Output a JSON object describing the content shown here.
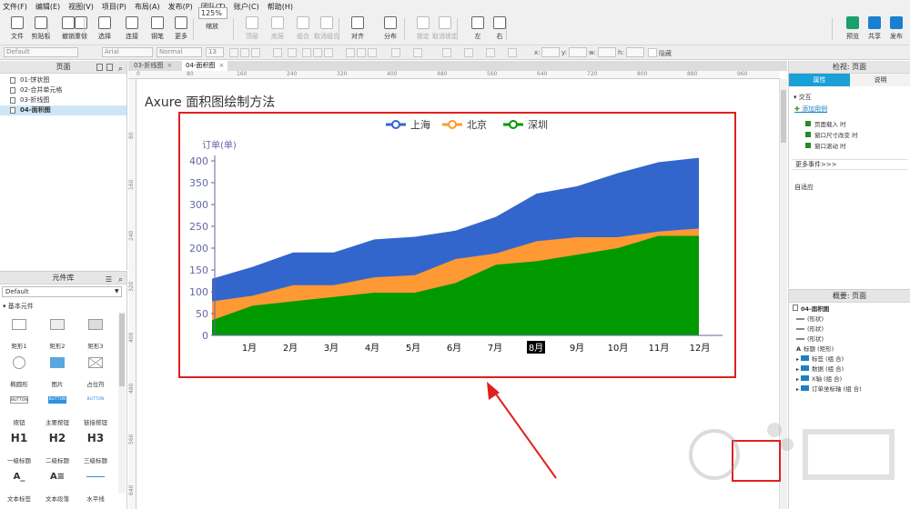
{
  "menubar": [
    "文件(F)",
    "编辑(E)",
    "视图(V)",
    "项目(P)",
    "布局(A)",
    "发布(P)",
    "团队(T)",
    "账户(C)",
    "帮助(H)"
  ],
  "toolbar": {
    "groups": [
      {
        "label": "文件",
        "icon": "new-file-icon"
      },
      {
        "label": "剪贴板",
        "icon": "clipboard-icon"
      },
      {
        "label": "撤销",
        "icon": "undo-icon"
      },
      {
        "label": "重做",
        "icon": "redo-icon"
      },
      {
        "label": "选择",
        "icon": "select-icon"
      },
      {
        "label": "连接",
        "icon": "connect-icon"
      },
      {
        "label": "钢笔",
        "icon": "pen-icon"
      },
      {
        "label": "更多",
        "icon": "more-icon"
      },
      {
        "label": "顶层",
        "icon": "bring-front-icon"
      },
      {
        "label": "底层",
        "icon": "send-back-icon"
      },
      {
        "label": "组合",
        "icon": "group-icon"
      },
      {
        "label": "取消组合",
        "icon": "ungroup-icon"
      },
      {
        "label": "对齐",
        "icon": "align-icon"
      },
      {
        "label": "分布",
        "icon": "distribute-icon"
      },
      {
        "label": "锁定",
        "icon": "lock-icon"
      },
      {
        "label": "取消锁定",
        "icon": "unlock-icon"
      },
      {
        "label": "左",
        "icon": "left-icon"
      },
      {
        "label": "右",
        "icon": "right-icon"
      },
      {
        "label": "预览",
        "icon": "preview-icon"
      },
      {
        "label": "共享",
        "icon": "share-icon"
      },
      {
        "label": "发布",
        "icon": "publish-icon"
      }
    ],
    "zoom": "125%",
    "zoom_label": "缩放"
  },
  "formatbar": {
    "style": "Default",
    "font": "Arial",
    "weight": "Normal",
    "size": "13",
    "x_label": "x:",
    "y_label": "y:",
    "w_label": "w:",
    "h_label": "h:",
    "hidden_label": "隐藏"
  },
  "pages": {
    "title": "页面",
    "items": [
      {
        "label": "01-饼状图",
        "selected": false
      },
      {
        "label": "02-合并单元格",
        "selected": false
      },
      {
        "label": "03-折线图",
        "selected": false
      },
      {
        "label": "04-面积图",
        "selected": true
      }
    ]
  },
  "library": {
    "title": "元件库",
    "selected": "Default",
    "category": "基本元件",
    "widgets": [
      {
        "label": "矩形1"
      },
      {
        "label": "矩形2"
      },
      {
        "label": "矩形3"
      },
      {
        "label": "椭圆形"
      },
      {
        "label": "图片"
      },
      {
        "label": "占位符"
      },
      {
        "label": "按钮",
        "tag": "BUTTON"
      },
      {
        "label": "主要按钮",
        "tag": "BUTTON"
      },
      {
        "label": "链接按钮",
        "tag": "BUTTON"
      },
      {
        "label": "一级标题",
        "tag": "H1"
      },
      {
        "label": "二级标题",
        "tag": "H2"
      },
      {
        "label": "三级标题",
        "tag": "H3"
      },
      {
        "label": "文本标签",
        "tag": "A_"
      },
      {
        "label": "文本段落",
        "tag": "A≡"
      },
      {
        "label": "水平线"
      }
    ]
  },
  "canvas": {
    "tabs": [
      {
        "label": "03-折线图",
        "active": false
      },
      {
        "label": "04-面积图",
        "active": true
      }
    ],
    "ruler_top": [
      "0",
      "80",
      "160",
      "240",
      "320",
      "400",
      "480",
      "560",
      "640",
      "720",
      "800",
      "880",
      "960"
    ],
    "ruler_left": [
      "80",
      "160",
      "240",
      "320",
      "400",
      "480",
      "560",
      "640"
    ],
    "page_title": "Axure 面积图绘制方法"
  },
  "chart_data": {
    "type": "area",
    "title": "",
    "ylabel": "订单(单)",
    "categories": [
      "1月",
      "2月",
      "3月",
      "4月",
      "5月",
      "6月",
      "7月",
      "8月",
      "9月",
      "10月",
      "11月",
      "12月"
    ],
    "highlighted_category": "8月",
    "yticks": [
      "0",
      "50",
      "100",
      "150",
      "200",
      "250",
      "300",
      "350",
      "400"
    ],
    "ylim": [
      0,
      400
    ],
    "legend_position": "top",
    "series": [
      {
        "name": "上海",
        "color": "#3366cc",
        "values": [
          130,
          157,
          190,
          190,
          220,
          226,
          240,
          272,
          325,
          342,
          372,
          397,
          407
        ]
      },
      {
        "name": "北京",
        "color": "#ff9933",
        "values": [
          78,
          91,
          115,
          115,
          133,
          138,
          175,
          188,
          216,
          225,
          225,
          238,
          245
        ]
      },
      {
        "name": "深圳",
        "color": "#009900",
        "values": [
          35,
          68,
          78,
          88,
          98,
          98,
          120,
          162,
          170,
          185,
          200,
          228,
          228
        ]
      }
    ]
  },
  "inspector": {
    "title": "检视: 页面",
    "tabs": [
      "属性",
      "说明"
    ],
    "section": "交互",
    "add_case": "添加用例",
    "events": [
      "页面载入 时",
      "窗口尺寸改变 时",
      "窗口滚动 时"
    ],
    "more_events": "更多事件>>>",
    "adaptive": "自适应"
  },
  "outline": {
    "title": "概要: 页面",
    "items": [
      {
        "label": "04-面积图",
        "kind": "page"
      },
      {
        "label": "(形状)",
        "kind": "shape"
      },
      {
        "label": "(形状)",
        "kind": "shape"
      },
      {
        "label": "(形状)",
        "kind": "shape"
      },
      {
        "label": "标题 (矩形)",
        "kind": "text"
      },
      {
        "label": "标签 (组 合)",
        "kind": "folder"
      },
      {
        "label": "数据 (组 合)",
        "kind": "folder"
      },
      {
        "label": "X轴 (组 合)",
        "kind": "folder"
      },
      {
        "label": "订单坐标轴 (组 合)",
        "kind": "folder"
      }
    ]
  },
  "colors": {
    "accent": "#1a9fd6",
    "highlight_red": "#e0201c",
    "axis_text": "#6666aa"
  }
}
